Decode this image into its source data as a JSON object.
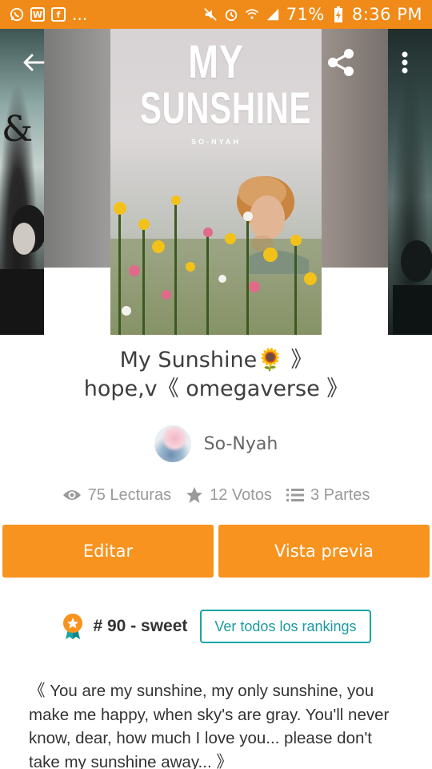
{
  "status_bar": {
    "battery": "71%",
    "time": "8:36 PM",
    "notif_dots": "..."
  },
  "cover": {
    "title_line1": "MY",
    "title_line2": "SUNSHINE",
    "author": "SO-NYAH"
  },
  "story": {
    "title_line1": "My Sunshine🌻 》",
    "title_line2": "hope,v《 omegaverse 》",
    "author": "So-Nyah"
  },
  "stats": {
    "reads": "75 Lecturas",
    "votes": "12 Votos",
    "parts": "3 Partes"
  },
  "actions": {
    "edit": "Editar",
    "preview": "Vista previa"
  },
  "ranking": {
    "rank": "# 90 - sweet",
    "view_all": "Ver todos los rankings"
  },
  "description": "《 You are my sunshine, my only sunshine, you make me happy, when sky's are gray. You'll never know, dear, how much I love you... please don't take my sunshine away... 》",
  "colors": {
    "accent": "#f7931e",
    "status_bar": "#f08a18",
    "ranking_button": "#1ba3a3"
  }
}
